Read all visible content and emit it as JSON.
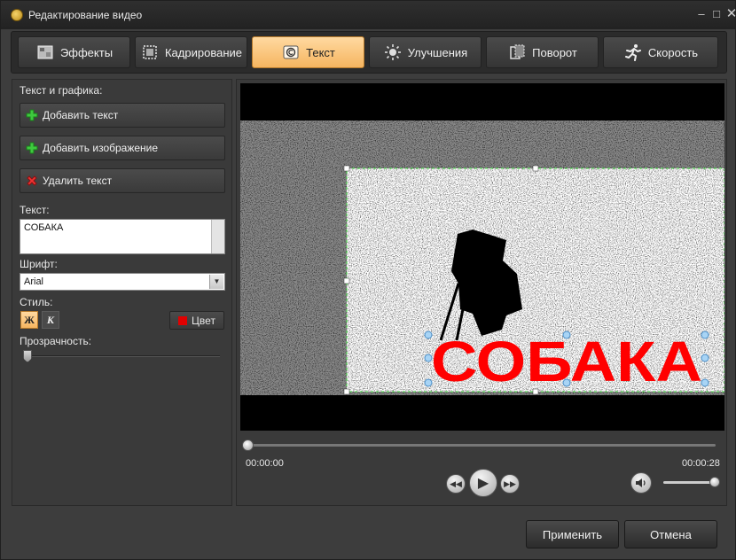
{
  "window": {
    "title": "Редактирование видео",
    "minimize": "–",
    "maximize": "□",
    "close": "✕"
  },
  "tabs": [
    {
      "label": "Эффекты",
      "icon": "effects-icon"
    },
    {
      "label": "Кадрирование",
      "icon": "crop-icon"
    },
    {
      "label": "Текст",
      "icon": "text-icon",
      "active": true
    },
    {
      "label": "Улучшения",
      "icon": "brightness-icon"
    },
    {
      "label": "Поворот",
      "icon": "rotate-icon"
    },
    {
      "label": "Скорость",
      "icon": "running-man-icon"
    }
  ],
  "left_panel": {
    "section_title": "Текст и графика:",
    "add_text": "Добавить текст",
    "add_image": "Добавить изображение",
    "delete_text": "Удалить текст",
    "text_label": "Текст:",
    "text_value": "СОБАКА",
    "font_label": "Шрифт:",
    "font_value": "Arial",
    "style_label": "Стиль:",
    "bold_label": "Ж",
    "italic_label": "К",
    "color_label": "Цвет",
    "color_value": "#e00000",
    "opacity_label": "Прозрачность:",
    "opacity_level": 0
  },
  "preview": {
    "overlay_text": "СОБАКА",
    "overlay_color": "#ff0000",
    "time_start": "00:00:00",
    "time_end": "00:00:28",
    "playback_position": 0,
    "volume_level": 1.0
  },
  "actions": {
    "apply": "Применить",
    "cancel": "Отмена"
  },
  "colors": {
    "accent_tab": "#f6b560",
    "background": "#3d3d3d",
    "titlebar": "#222222"
  }
}
